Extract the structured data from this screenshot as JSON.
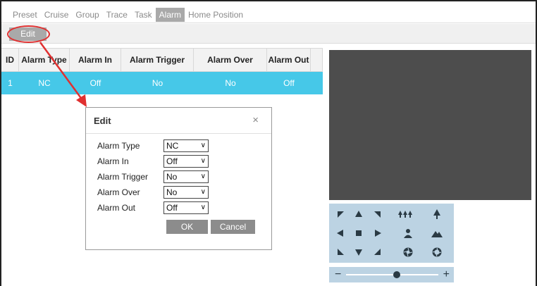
{
  "tabs": [
    {
      "label": "Preset"
    },
    {
      "label": "Cruise"
    },
    {
      "label": "Group"
    },
    {
      "label": "Trace"
    },
    {
      "label": "Task"
    },
    {
      "label": "Alarm"
    },
    {
      "label": "Home Position"
    }
  ],
  "active_tab": "Alarm",
  "toolbar": {
    "edit_label": "Edit"
  },
  "table": {
    "columns": [
      "ID",
      "Alarm Type",
      "Alarm In",
      "Alarm Trigger",
      "Alarm Over",
      "Alarm Out"
    ],
    "rows": [
      [
        "1",
        "NC",
        "Off",
        "No",
        "No",
        "Off"
      ]
    ]
  },
  "dialog": {
    "title": "Edit",
    "close_glyph": "×",
    "fields": [
      {
        "label": "Alarm Type",
        "value": "NC"
      },
      {
        "label": "Alarm In",
        "value": "Off"
      },
      {
        "label": "Alarm Trigger",
        "value": "No"
      },
      {
        "label": "Alarm Over",
        "value": "No"
      },
      {
        "label": "Alarm Out",
        "value": "Off"
      }
    ],
    "ok_label": "OK",
    "cancel_label": "Cancel"
  },
  "zoom": {
    "minus": "−",
    "plus": "+",
    "level": 0.55
  },
  "colors": {
    "accent_row": "#46c8e8",
    "annotation": "#e03030",
    "video_bg": "#4d4d4d",
    "ptz_bg": "#bcd3e3"
  },
  "icons": {
    "ptz": [
      "up-left-arrow-icon",
      "up-arrow-icon",
      "up-right-arrow-icon",
      "left-arrow-icon",
      "stop-icon",
      "right-arrow-icon",
      "down-left-arrow-icon",
      "down-arrow-icon",
      "down-right-arrow-icon"
    ],
    "lens": [
      "zoom-out-trees-icon",
      "zoom-in-tree-icon",
      "focus-person-icon",
      "focus-mountain-icon",
      "iris-close-icon",
      "iris-open-icon"
    ]
  }
}
